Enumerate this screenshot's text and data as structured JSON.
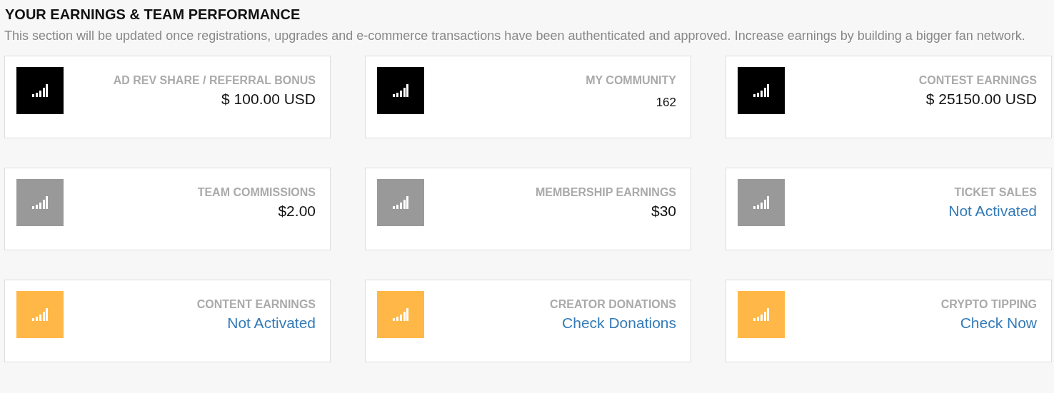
{
  "section": {
    "title": "YOUR EARNINGS & TEAM PERFORMANCE",
    "description": "This section will be updated once registrations, upgrades and e-commerce transactions have been authenticated and approved. Increase earnings by building a bigger fan network."
  },
  "cards": [
    {
      "label": "AD REV SHARE / REFERRAL BONUS",
      "value": "$ 100.00 USD",
      "kind": "amount",
      "color": "#000000"
    },
    {
      "label": "MY COMMUNITY",
      "value": "162",
      "kind": "count",
      "color": "#000000"
    },
    {
      "label": "CONTEST EARNINGS",
      "value": "$ 25150.00 USD",
      "kind": "amount",
      "color": "#000000"
    },
    {
      "label": "TEAM COMMISSIONS",
      "value": "$2.00",
      "kind": "amount",
      "color": "#999999"
    },
    {
      "label": "MEMBERSHIP EARNINGS",
      "value": "$30",
      "kind": "amount",
      "color": "#999999"
    },
    {
      "label": "TICKET SALES",
      "value": "Not Activated",
      "kind": "link",
      "color": "#999999"
    },
    {
      "label": "CONTENT EARNINGS",
      "value": "Not Activated",
      "kind": "link",
      "color": "#ffb848"
    },
    {
      "label": "CREATOR DONATIONS",
      "value": "Check Donations",
      "kind": "link",
      "color": "#ffb848"
    },
    {
      "label": "CRYPTO TIPPING",
      "value": "Check Now",
      "kind": "link",
      "color": "#ffb848"
    }
  ]
}
